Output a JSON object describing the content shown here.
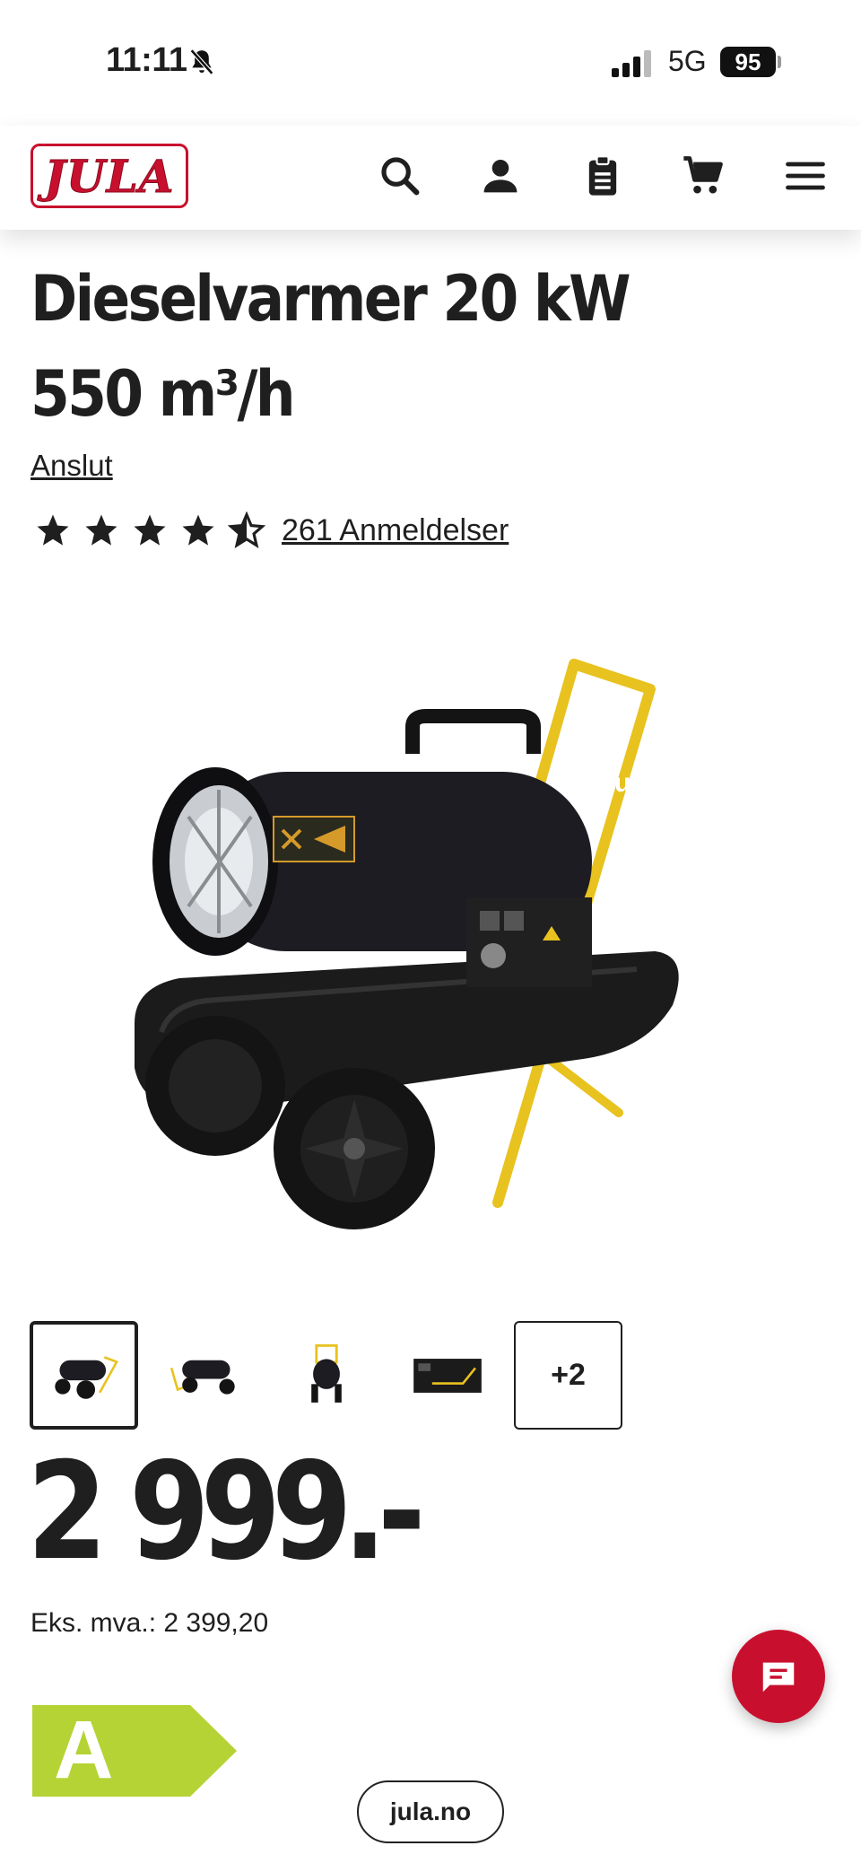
{
  "status_bar": {
    "time": "11:11",
    "network": "5G",
    "battery": "95"
  },
  "header": {
    "logo_text": "JULA",
    "icons": [
      "search-icon",
      "account-icon",
      "clipboard-icon",
      "cart-icon",
      "menu-icon"
    ]
  },
  "product": {
    "title": "Dieselvarmer 20 kW 550 m³/h",
    "brand": "Anslut",
    "rating": 4.5,
    "rating_max": 5,
    "reviews_label": "261 Anmeldelser",
    "image_brand_text": "anslut",
    "thumbnails_more": "+2",
    "price": "2 999.-",
    "ex_vat_label": "Eks. mva.: 2 399,20",
    "energy_class": "A"
  },
  "colors": {
    "brand_red": "#c8102e",
    "energy_green": "#b5d334",
    "frame_yellow": "#e8c21f"
  },
  "browser": {
    "url": "jula.no"
  }
}
